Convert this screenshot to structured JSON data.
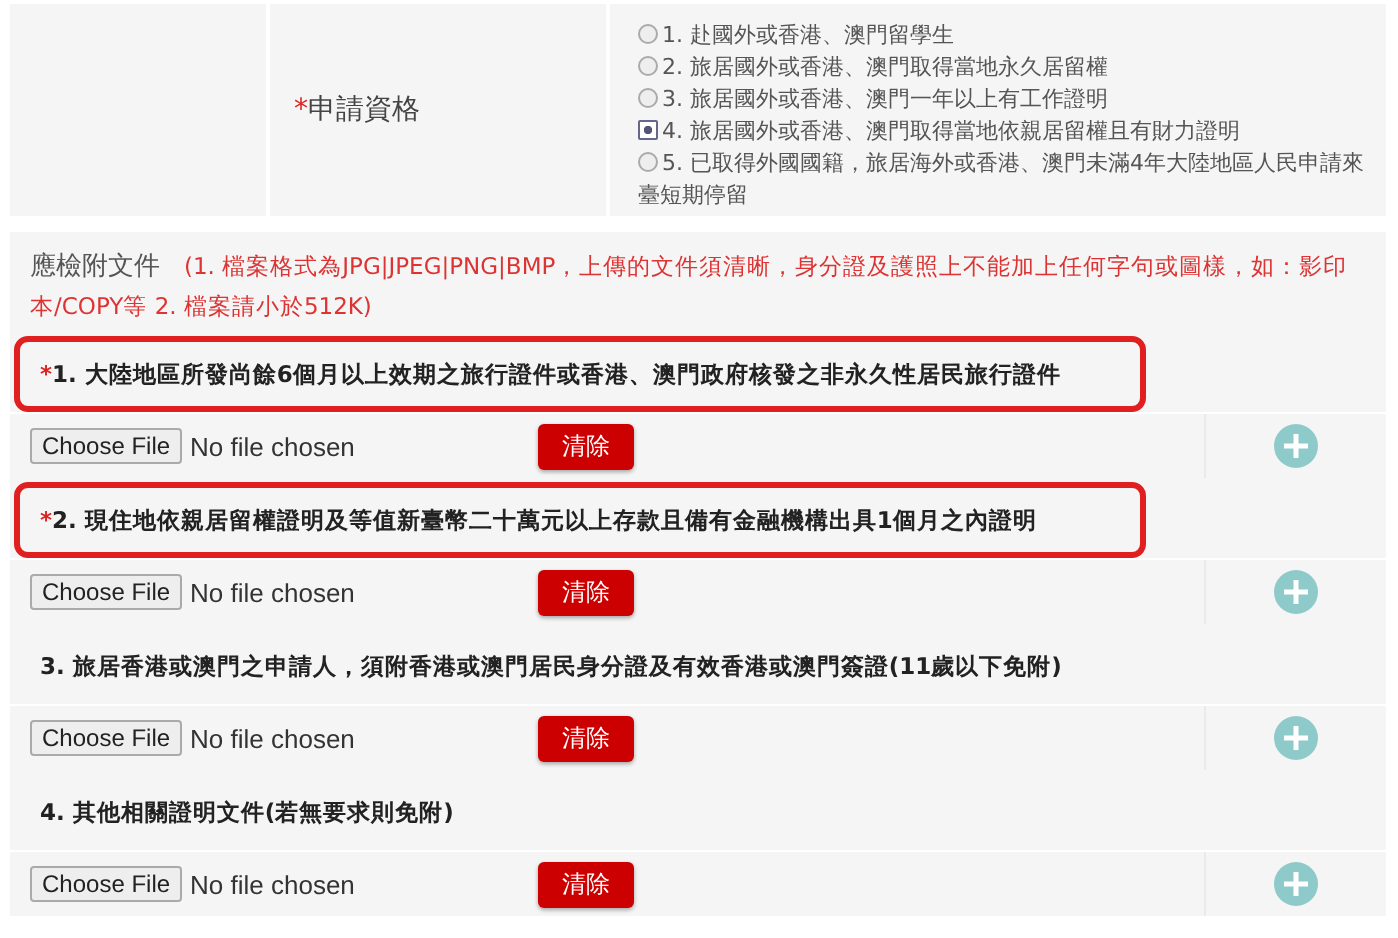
{
  "qualification": {
    "required_mark": "*",
    "label": "申請資格",
    "options": [
      {
        "label": "1. 赴國外或香港、澳門留學生",
        "selected": false
      },
      {
        "label": "2. 旅居國外或香港、澳門取得當地永久居留權",
        "selected": false
      },
      {
        "label": "3. 旅居國外或香港、澳門一年以上有工作證明",
        "selected": false
      },
      {
        "label": "4. 旅居國外或香港、澳門取得當地依親居留權且有財力證明",
        "selected": true
      },
      {
        "label": "5. 已取得外國國籍，旅居海外或香港、澳門未滿4年大陸地區人民申請來臺短期停留",
        "selected": false
      }
    ]
  },
  "attachments": {
    "label": "應檢附文件",
    "note": "(1. 檔案格式為JPG|JPEG|PNG|BMP，上傳的文件須清晰，身分證及護照上不能加上任何字句或圖樣，如：影印本/COPY等  2. 檔案請小於512K)",
    "items": [
      {
        "required_mark": "*",
        "title": "1. 大陸地區所發尚餘6個月以上效期之旅行證件或香港、澳門政府核發之非永久性居民旅行證件",
        "highlighted": true,
        "file_button": "Choose File",
        "file_status": "No file chosen",
        "clear_button": "清除"
      },
      {
        "required_mark": "*",
        "title": "2. 現住地依親居留權證明及等值新臺幣二十萬元以上存款且備有金融機構出具1個月之內證明",
        "highlighted": true,
        "file_button": "Choose File",
        "file_status": "No file chosen",
        "clear_button": "清除"
      },
      {
        "title": "3. 旅居香港或澳門之申請人，須附香港或澳門居民身分證及有效香港或澳門簽證(11歲以下免附)",
        "highlighted": false,
        "file_button": "Choose File",
        "file_status": "No file chosen",
        "clear_button": "清除"
      },
      {
        "title": "4. 其他相關證明文件(若無要求則免附)",
        "highlighted": false,
        "file_button": "Choose File",
        "file_status": "No file chosen",
        "clear_button": "清除"
      }
    ]
  }
}
